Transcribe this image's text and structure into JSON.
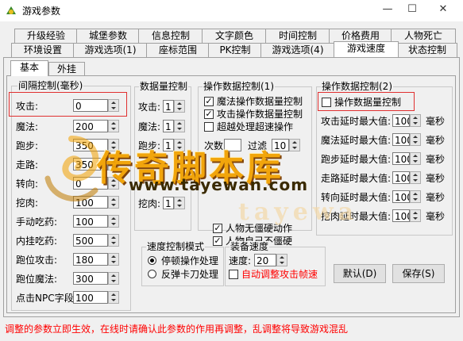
{
  "window": {
    "title": "游戏参数",
    "min": "—",
    "max": "☐",
    "close": "✕"
  },
  "tabs_row1": [
    "升级经验",
    "城堡参数",
    "信息控制",
    "文字颜色",
    "时间控制",
    "价格费用",
    "人物死亡"
  ],
  "tabs_row2": [
    "环境设置",
    "游戏选项(1)",
    "座标范围",
    "PK控制",
    "游戏选项(4)",
    "游戏速度",
    "状态控制"
  ],
  "active_tab": "游戏速度",
  "subtabs": [
    "基本",
    "外挂"
  ],
  "interval": {
    "title": "间隔控制(毫秒)",
    "rows": [
      {
        "label": "攻击:",
        "value": "0"
      },
      {
        "label": "魔法:",
        "value": "200"
      },
      {
        "label": "跑步:",
        "value": "350"
      },
      {
        "label": "走路:",
        "value": "350"
      },
      {
        "label": "转向:",
        "value": "0"
      },
      {
        "label": "挖肉:",
        "value": "100"
      },
      {
        "label": "手动吃药:",
        "value": "100"
      },
      {
        "label": "内挂吃药:",
        "value": "500"
      },
      {
        "label": "跑位攻击:",
        "value": "180"
      },
      {
        "label": "跑位魔法:",
        "value": "300"
      },
      {
        "label": "点击NPC字段:",
        "value": "100"
      }
    ]
  },
  "dataqty": {
    "title": "数据量控制",
    "rows": [
      {
        "label": "攻击:",
        "value": "1"
      },
      {
        "label": "魔法:",
        "value": "1"
      },
      {
        "label": "跑步:",
        "value": "1"
      },
      {
        "label": "挖肉:",
        "value": "1"
      }
    ]
  },
  "opctrl1": {
    "title": "操作数据控制(1)",
    "checks": [
      {
        "label": "魔法操作数据量控制",
        "checked": true
      },
      {
        "label": "攻击操作数据量控制",
        "checked": true
      },
      {
        "label": "超越处理超速操作",
        "checked": false
      }
    ],
    "count_label": "次数",
    "count_value": "",
    "fail_label": "过滤",
    "fail_value": "10",
    "checks2": [
      {
        "label": "人物无僵硬动作",
        "checked": true
      },
      {
        "label": "人物自己不僵硬",
        "checked": true
      }
    ]
  },
  "opctrl2": {
    "title": "操作数据控制(2)",
    "check": {
      "label": "操作数据量控制",
      "checked": false
    },
    "unit": "毫秒",
    "rows": [
      {
        "label": "攻击延时最大值:",
        "value": "100"
      },
      {
        "label": "魔法延时最大值:",
        "value": "100"
      },
      {
        "label": "跑步延时最大值:",
        "value": "100"
      },
      {
        "label": "走路延时最大值:",
        "value": "100"
      },
      {
        "label": "转向延时最大值:",
        "value": "100"
      },
      {
        "label": "挖肉延时最大值:",
        "value": "100"
      }
    ]
  },
  "speedmode": {
    "title": "速度控制模式",
    "options": [
      {
        "label": "停顿操作处理",
        "selected": true
      },
      {
        "label": "反弹卡刀处理",
        "selected": false
      }
    ]
  },
  "equipspeed": {
    "title": "装备速度",
    "speed_label": "速度:",
    "speed_value": "20",
    "auto_label": "自动调整攻击帧速",
    "auto_checked": false
  },
  "buttons": {
    "default": "默认(D)",
    "save": "保存(S)"
  },
  "footer": "调整的参数立即生效，在线时请确认此参数的作用再调整，乱调整将导致游戏混乱",
  "watermark": {
    "main": "传奇脚本库",
    "url": "www.tayewan.com",
    "faint": "tayewa"
  },
  "colors": {
    "warning": "#ff0000",
    "highlight_box": "#e03030",
    "watermark_gold": "#f2a100"
  }
}
